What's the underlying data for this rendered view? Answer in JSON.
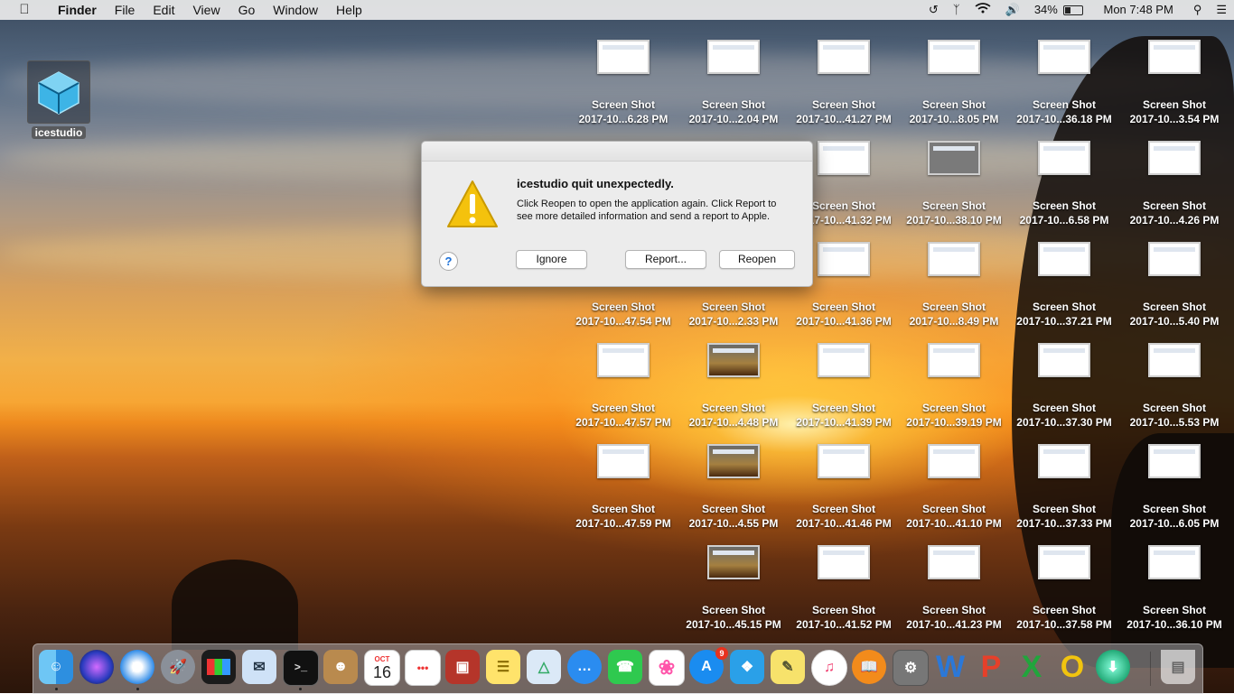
{
  "menubar": {
    "app": "Finder",
    "items": [
      "File",
      "Edit",
      "View",
      "Go",
      "Window",
      "Help"
    ],
    "battery": "34%",
    "clock": "Mon 7:48 PM"
  },
  "desktop_app": {
    "label": "icestudio"
  },
  "files": [
    {
      "title": "Screen Shot",
      "name": "2017-10...6.28 PM"
    },
    {
      "title": "Screen Shot",
      "name": "2017-10...2.04 PM"
    },
    {
      "title": "Screen Shot",
      "name": "2017-10...41.27 PM"
    },
    {
      "title": "Screen Shot",
      "name": "2017-10...8.05 PM"
    },
    {
      "title": "Screen Shot",
      "name": "2017-10...36.18 PM"
    },
    {
      "title": "Screen Shot",
      "name": "2017-10...3.54 PM"
    },
    {
      "title": "Screen Shot",
      "name": "2017-10...41.32 PM"
    },
    {
      "title": "Screen Shot",
      "name": "2017-10...38.10 PM"
    },
    {
      "title": "Screen Shot",
      "name": "2017-10...6.58 PM"
    },
    {
      "title": "Screen Shot",
      "name": "2017-10...4.26 PM"
    },
    {
      "title": "Screen Shot",
      "name": "2017-10...47.54 PM"
    },
    {
      "title": "Screen Shot",
      "name": "2017-10...2.33 PM"
    },
    {
      "title": "Screen Shot",
      "name": "2017-10...41.36 PM"
    },
    {
      "title": "Screen Shot",
      "name": "2017-10...8.49 PM"
    },
    {
      "title": "Screen Shot",
      "name": "2017-10...37.21 PM"
    },
    {
      "title": "Screen Shot",
      "name": "2017-10...5.40 PM"
    },
    {
      "title": "Screen Shot",
      "name": "2017-10...47.57 PM"
    },
    {
      "title": "Screen Shot",
      "name": "2017-10...4.48 PM"
    },
    {
      "title": "Screen Shot",
      "name": "2017-10...41.39 PM"
    },
    {
      "title": "Screen Shot",
      "name": "2017-10...39.19 PM"
    },
    {
      "title": "Screen Shot",
      "name": "2017-10...37.30 PM"
    },
    {
      "title": "Screen Shot",
      "name": "2017-10...5.53 PM"
    },
    {
      "title": "Screen Shot",
      "name": "2017-10...47.59 PM"
    },
    {
      "title": "Screen Shot",
      "name": "2017-10...4.55 PM"
    },
    {
      "title": "Screen Shot",
      "name": "2017-10...41.46 PM"
    },
    {
      "title": "Screen Shot",
      "name": "2017-10...41.10 PM"
    },
    {
      "title": "Screen Shot",
      "name": "2017-10...37.33 PM"
    },
    {
      "title": "Screen Shot",
      "name": "2017-10...6.05 PM"
    },
    {
      "title": "Screen Shot",
      "name": "2017-10...45.15 PM"
    },
    {
      "title": "Screen Shot",
      "name": "2017-10...41.52 PM"
    },
    {
      "title": "Screen Shot",
      "name": "2017-10...41.23 PM"
    },
    {
      "title": "Screen Shot",
      "name": "2017-10...37.58 PM"
    },
    {
      "title": "Screen Shot",
      "name": "2017-10...36.10 PM"
    }
  ],
  "dialog": {
    "title": "icestudio quit unexpectedly.",
    "message": "Click Reopen to open the application again. Click Report to see more detailed information and send a report to Apple.",
    "help": "?",
    "ignore": "Ignore",
    "report": "Report...",
    "reopen": "Reopen"
  },
  "dock": {
    "calendar_month": "OCT",
    "calendar_day": "16",
    "appstore_badge": "9",
    "icons": [
      "finder-icon",
      "siri-icon",
      "safari-icon",
      "launchpad-icon",
      "activity-monitor-icon",
      "mail-icon",
      "terminal-icon",
      "contacts-icon",
      "calendar-icon",
      "reminders-icon",
      "photo-booth-icon",
      "notes-icon",
      "preview-icon",
      "messages-icon",
      "facetime-icon",
      "photos-icon",
      "app-store-icon",
      "icestudio-icon",
      "stickies-icon",
      "itunes-icon",
      "ibooks-icon",
      "system-preferences-icon",
      "word-icon",
      "powerpoint-icon",
      "excel-icon",
      "outlook-icon",
      "downloader-icon",
      "trash-icon"
    ]
  }
}
